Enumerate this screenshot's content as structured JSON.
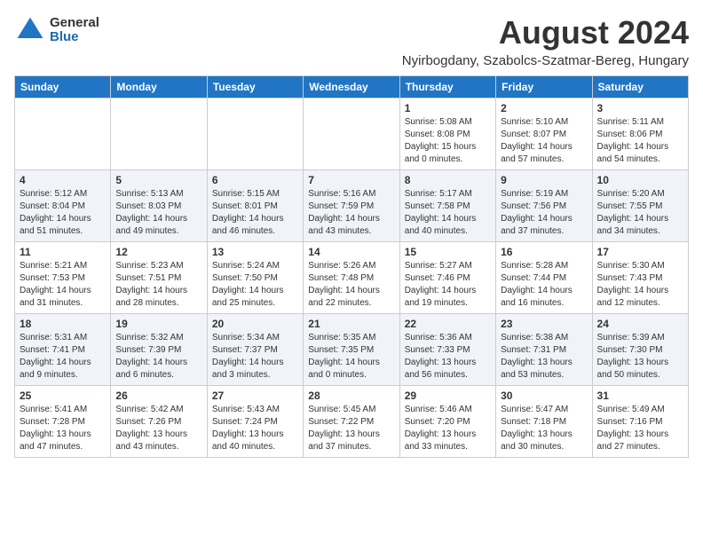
{
  "logo": {
    "general": "General",
    "blue": "Blue"
  },
  "title": {
    "month_year": "August 2024",
    "location": "Nyirbogdany, Szabolcs-Szatmar-Bereg, Hungary"
  },
  "headers": [
    "Sunday",
    "Monday",
    "Tuesday",
    "Wednesday",
    "Thursday",
    "Friday",
    "Saturday"
  ],
  "weeks": [
    [
      {
        "day": "",
        "info": ""
      },
      {
        "day": "",
        "info": ""
      },
      {
        "day": "",
        "info": ""
      },
      {
        "day": "",
        "info": ""
      },
      {
        "day": "1",
        "info": "Sunrise: 5:08 AM\nSunset: 8:08 PM\nDaylight: 15 hours\nand 0 minutes."
      },
      {
        "day": "2",
        "info": "Sunrise: 5:10 AM\nSunset: 8:07 PM\nDaylight: 14 hours\nand 57 minutes."
      },
      {
        "day": "3",
        "info": "Sunrise: 5:11 AM\nSunset: 8:06 PM\nDaylight: 14 hours\nand 54 minutes."
      }
    ],
    [
      {
        "day": "4",
        "info": "Sunrise: 5:12 AM\nSunset: 8:04 PM\nDaylight: 14 hours\nand 51 minutes."
      },
      {
        "day": "5",
        "info": "Sunrise: 5:13 AM\nSunset: 8:03 PM\nDaylight: 14 hours\nand 49 minutes."
      },
      {
        "day": "6",
        "info": "Sunrise: 5:15 AM\nSunset: 8:01 PM\nDaylight: 14 hours\nand 46 minutes."
      },
      {
        "day": "7",
        "info": "Sunrise: 5:16 AM\nSunset: 7:59 PM\nDaylight: 14 hours\nand 43 minutes."
      },
      {
        "day": "8",
        "info": "Sunrise: 5:17 AM\nSunset: 7:58 PM\nDaylight: 14 hours\nand 40 minutes."
      },
      {
        "day": "9",
        "info": "Sunrise: 5:19 AM\nSunset: 7:56 PM\nDaylight: 14 hours\nand 37 minutes."
      },
      {
        "day": "10",
        "info": "Sunrise: 5:20 AM\nSunset: 7:55 PM\nDaylight: 14 hours\nand 34 minutes."
      }
    ],
    [
      {
        "day": "11",
        "info": "Sunrise: 5:21 AM\nSunset: 7:53 PM\nDaylight: 14 hours\nand 31 minutes."
      },
      {
        "day": "12",
        "info": "Sunrise: 5:23 AM\nSunset: 7:51 PM\nDaylight: 14 hours\nand 28 minutes."
      },
      {
        "day": "13",
        "info": "Sunrise: 5:24 AM\nSunset: 7:50 PM\nDaylight: 14 hours\nand 25 minutes."
      },
      {
        "day": "14",
        "info": "Sunrise: 5:26 AM\nSunset: 7:48 PM\nDaylight: 14 hours\nand 22 minutes."
      },
      {
        "day": "15",
        "info": "Sunrise: 5:27 AM\nSunset: 7:46 PM\nDaylight: 14 hours\nand 19 minutes."
      },
      {
        "day": "16",
        "info": "Sunrise: 5:28 AM\nSunset: 7:44 PM\nDaylight: 14 hours\nand 16 minutes."
      },
      {
        "day": "17",
        "info": "Sunrise: 5:30 AM\nSunset: 7:43 PM\nDaylight: 14 hours\nand 12 minutes."
      }
    ],
    [
      {
        "day": "18",
        "info": "Sunrise: 5:31 AM\nSunset: 7:41 PM\nDaylight: 14 hours\nand 9 minutes."
      },
      {
        "day": "19",
        "info": "Sunrise: 5:32 AM\nSunset: 7:39 PM\nDaylight: 14 hours\nand 6 minutes."
      },
      {
        "day": "20",
        "info": "Sunrise: 5:34 AM\nSunset: 7:37 PM\nDaylight: 14 hours\nand 3 minutes."
      },
      {
        "day": "21",
        "info": "Sunrise: 5:35 AM\nSunset: 7:35 PM\nDaylight: 14 hours\nand 0 minutes."
      },
      {
        "day": "22",
        "info": "Sunrise: 5:36 AM\nSunset: 7:33 PM\nDaylight: 13 hours\nand 56 minutes."
      },
      {
        "day": "23",
        "info": "Sunrise: 5:38 AM\nSunset: 7:31 PM\nDaylight: 13 hours\nand 53 minutes."
      },
      {
        "day": "24",
        "info": "Sunrise: 5:39 AM\nSunset: 7:30 PM\nDaylight: 13 hours\nand 50 minutes."
      }
    ],
    [
      {
        "day": "25",
        "info": "Sunrise: 5:41 AM\nSunset: 7:28 PM\nDaylight: 13 hours\nand 47 minutes."
      },
      {
        "day": "26",
        "info": "Sunrise: 5:42 AM\nSunset: 7:26 PM\nDaylight: 13 hours\nand 43 minutes."
      },
      {
        "day": "27",
        "info": "Sunrise: 5:43 AM\nSunset: 7:24 PM\nDaylight: 13 hours\nand 40 minutes."
      },
      {
        "day": "28",
        "info": "Sunrise: 5:45 AM\nSunset: 7:22 PM\nDaylight: 13 hours\nand 37 minutes."
      },
      {
        "day": "29",
        "info": "Sunrise: 5:46 AM\nSunset: 7:20 PM\nDaylight: 13 hours\nand 33 minutes."
      },
      {
        "day": "30",
        "info": "Sunrise: 5:47 AM\nSunset: 7:18 PM\nDaylight: 13 hours\nand 30 minutes."
      },
      {
        "day": "31",
        "info": "Sunrise: 5:49 AM\nSunset: 7:16 PM\nDaylight: 13 hours\nand 27 minutes."
      }
    ]
  ]
}
